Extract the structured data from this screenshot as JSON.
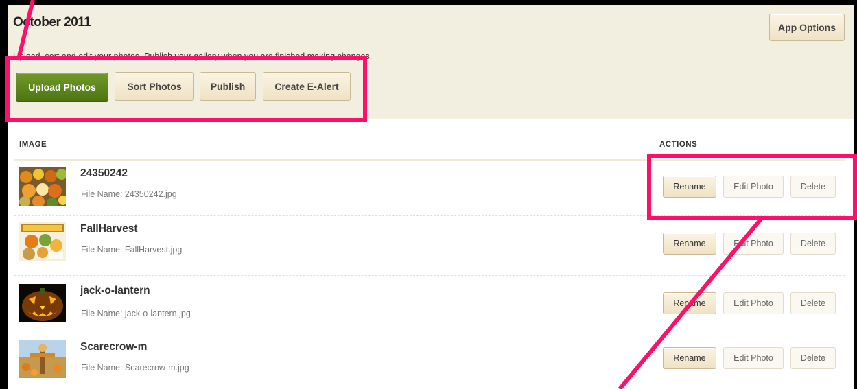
{
  "header": {
    "title": "October 2011",
    "subtitle": "Upload, sort and edit your photos. Publish your gallery when you are finished making changes.",
    "app_options_label": "App Options",
    "buttons": {
      "upload": "Upload Photos",
      "sort": "Sort Photos",
      "publish": "Publish",
      "ealert": "Create E-Alert"
    }
  },
  "table": {
    "columns": {
      "image": "IMAGE",
      "actions": "ACTIONS"
    },
    "rename_label": "Rename",
    "edit_label": "Edit Photo",
    "delete_label": "Delete",
    "rows": [
      {
        "title": "24350242",
        "file": "File Name: 24350242.jpg",
        "thumb": "pumpkins-gourds-thumbnail"
      },
      {
        "title": "FallHarvest",
        "file": "File Name: FallHarvest.jpg",
        "thumb": "fall-harvest-thumbnail"
      },
      {
        "title": "jack-o-lantern",
        "file": "File Name: jack-o-lantern.jpg",
        "thumb": "jack-o-lantern-thumbnail"
      },
      {
        "title": "Scarecrow-m",
        "file": "File Name: Scarecrow-m.jpg",
        "thumb": "scarecrow-thumbnail"
      }
    ]
  },
  "annotation": {
    "highlight_color": "#ff0f6a",
    "brand_green": "#5a8419"
  }
}
